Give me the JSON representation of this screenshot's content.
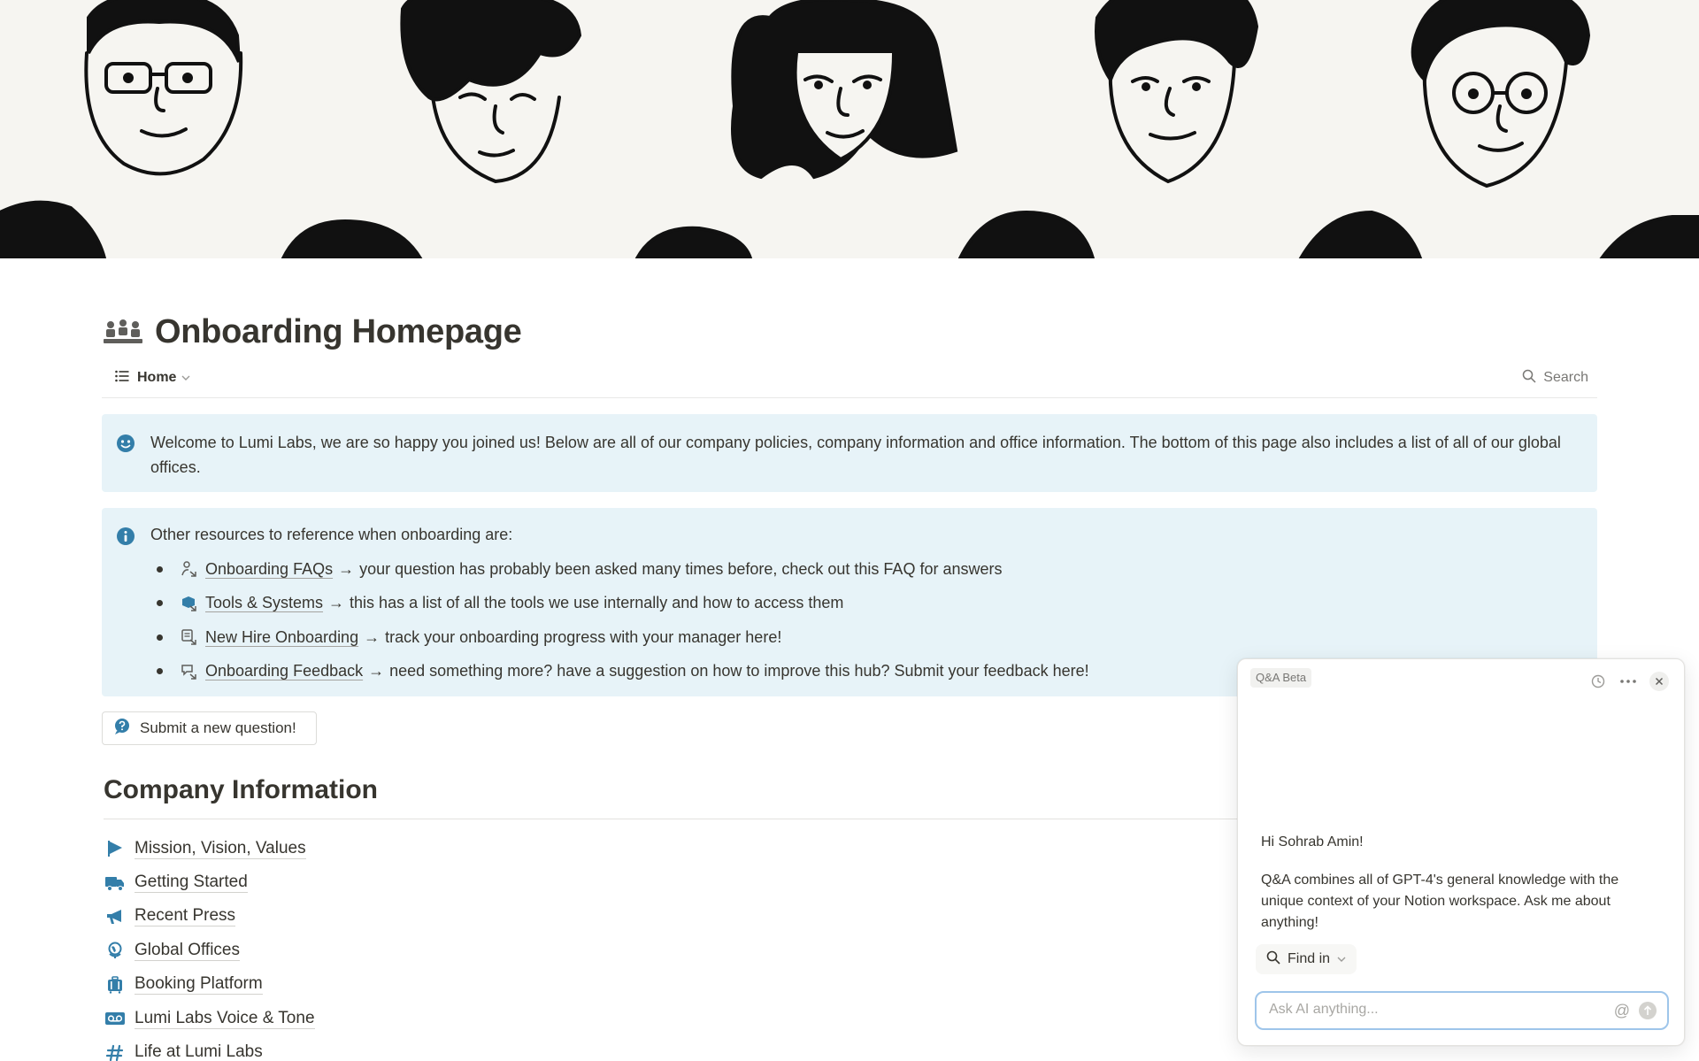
{
  "page": {
    "title": "Onboarding Homepage",
    "view_tab": "Home",
    "search_label": "Search"
  },
  "welcome": {
    "text": "Welcome to Lumi Labs, we are so happy you joined us! Below are all of our company policies, company information and office information. The bottom of this page also includes a list of all of our global offices."
  },
  "resources": {
    "heading": "Other resources to reference when onboarding are:",
    "arrow": "→",
    "items": [
      {
        "link": "Onboarding FAQs",
        "desc": "your question has probably been asked many times before, check out this FAQ for answers"
      },
      {
        "link": "Tools & Systems",
        "desc": "this has a list of all the tools we use internally and how to access them"
      },
      {
        "link": "New Hire Onboarding",
        "desc": "track your onboarding progress with your manager here!"
      },
      {
        "link": "Onboarding Feedback",
        "desc": "need something more? have a suggestion on how to improve this hub? Submit your feedback here!"
      }
    ]
  },
  "submit_button": "Submit a new question!",
  "company": {
    "heading": "Company Information",
    "pages": [
      {
        "label": "Mission, Vision, Values",
        "icon": "flag-icon"
      },
      {
        "label": "Getting Started",
        "icon": "truck-icon"
      },
      {
        "label": "Recent Press",
        "icon": "megaphone-icon"
      },
      {
        "label": "Global Offices",
        "icon": "globe-icon"
      },
      {
        "label": "Booking Platform",
        "icon": "luggage-icon"
      },
      {
        "label": "Lumi Labs Voice & Tone",
        "icon": "voicemail-icon"
      },
      {
        "label": "Life at Lumi Labs",
        "icon": "hash-icon"
      }
    ]
  },
  "qa": {
    "badge": "Q&A Beta",
    "greeting": "Hi Sohrab Amin!",
    "body": "Q&A combines all of GPT-4's general knowledge with the unique context of your Notion workspace. Ask me about anything!",
    "find_label": "Find in",
    "input_placeholder": "Ask AI anything...",
    "at_symbol": "@"
  },
  "colors": {
    "callout_bg": "#e7f3f8",
    "icon_blue": "#337ea9",
    "text": "#37352f",
    "muted": "#787774"
  }
}
